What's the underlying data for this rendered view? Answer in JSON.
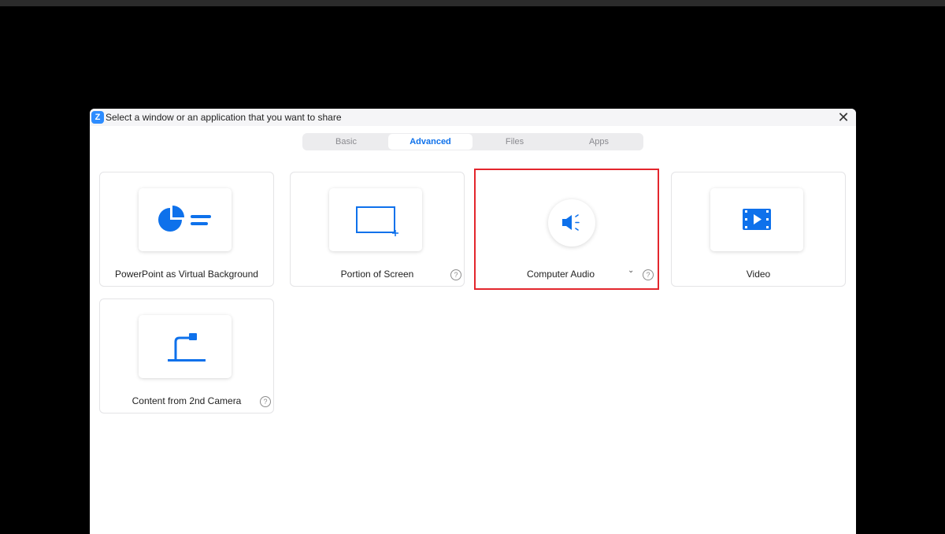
{
  "dialog": {
    "title": "Select a window or an application that you want to share",
    "app_logo_letter": "Z",
    "close_symbol": "✕",
    "accent_color": "#2d8cff",
    "highlight_color": "#e3262d"
  },
  "tabs": [
    {
      "label": "Basic",
      "active": false
    },
    {
      "label": "Advanced",
      "active": true
    },
    {
      "label": "Files",
      "active": false
    },
    {
      "label": "Apps",
      "active": false
    }
  ],
  "options": [
    {
      "label": "PowerPoint as Virtual Background",
      "icon": "pie-chart-icon",
      "help": false
    },
    {
      "label": "Portion of Screen",
      "icon": "screen-portion-icon",
      "help": true
    },
    {
      "label": "Computer Audio",
      "icon": "speaker-icon",
      "help": true,
      "dropdown": true,
      "highlighted": true
    },
    {
      "label": "Video",
      "icon": "film-icon",
      "help": false
    },
    {
      "label": "Content from 2nd Camera",
      "icon": "document-camera-icon",
      "help": true
    }
  ],
  "help_symbol": "?",
  "chevron_symbol": "⌄"
}
